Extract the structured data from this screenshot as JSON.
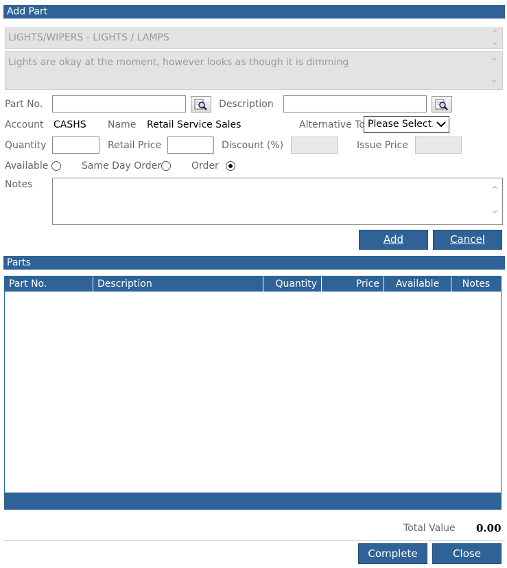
{
  "add_part": {
    "title": "Add Part",
    "category_text": "LIGHTS/WIPERS - LIGHTS / LAMPS",
    "fault_text": "Lights are okay at the moment, however looks as though it is dimming",
    "part_no_label": "Part No.",
    "part_no_value": "",
    "description_label": "Description",
    "description_value": "",
    "account_label": "Account",
    "account_value": "CASHS",
    "name_label": "Name",
    "name_value": "Retail Service Sales",
    "alternative_label": "Alternative To",
    "alternative_selected": "Please Select...",
    "quantity_label": "Quantity",
    "retail_price_label": "Retail Price",
    "discount_label": "Discount (%)",
    "issue_price_label": "Issue Price",
    "available_label": "Available",
    "same_day_label": "Same Day Order",
    "order_label": "Order",
    "notes_label": "Notes",
    "add_button": "Add",
    "cancel_button": "Cancel"
  },
  "parts": {
    "title": "Parts",
    "columns": [
      "Part No.",
      "Description",
      "Quantity",
      "Price",
      "Available",
      "Notes"
    ],
    "rows": []
  },
  "footer": {
    "total_label": "Total Value",
    "total_value": "0.00",
    "complete_button": "Complete",
    "close_button": "Close"
  },
  "colors": {
    "header_blue": "#2f6397",
    "readonly_gray": "#e3e3e3"
  },
  "selected_option": "Order"
}
